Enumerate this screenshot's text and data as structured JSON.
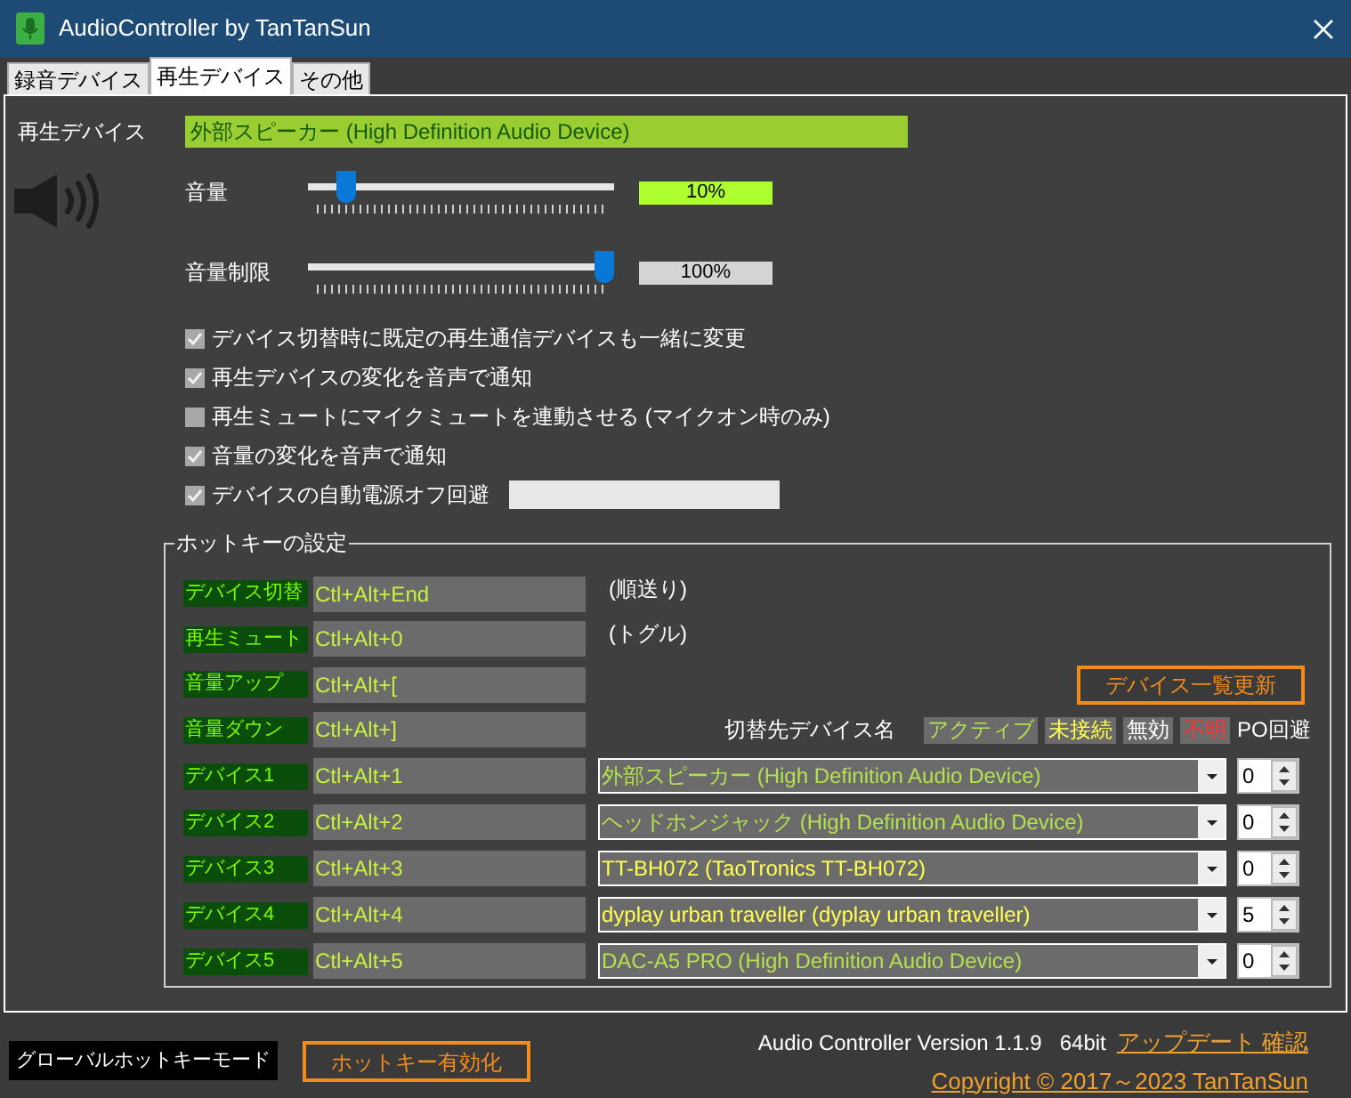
{
  "window": {
    "title": "AudioController by TanTanSun"
  },
  "tabs": [
    {
      "label": "録音デバイス",
      "selected": false
    },
    {
      "label": "再生デバイス",
      "selected": true
    },
    {
      "label": "その他",
      "selected": false
    }
  ],
  "device": {
    "label": "再生デバイス",
    "value": "外部スピーカー (High Definition Audio Device)"
  },
  "sliders": [
    {
      "label": "音量",
      "level": 0.1,
      "reading": "10%",
      "color": "#adff2f"
    },
    {
      "label": "音量制限",
      "level": 1,
      "reading": "100%",
      "color": "#d4d4d4"
    }
  ],
  "options": [
    {
      "kind": "plain",
      "label": "デバイス切替時に既定の再生通信デバイスも一緒に変更",
      "checked": true
    },
    {
      "kind": "plain",
      "label": "再生デバイスの変化を音声で通知",
      "checked": true
    },
    {
      "kind": "plain",
      "label": "再生ミュートにマイクミュートを連動させる (マイクオン時のみ)",
      "checked": false
    },
    {
      "kind": "plain",
      "label": "音量の変化を音声で通知",
      "checked": true
    },
    {
      "kind": "with-field",
      "label": "デバイスの自動電源オフ回避",
      "checked": true
    }
  ],
  "hotkeys": {
    "title": "ホットキーの設定",
    "actions": [
      {
        "label": "デバイス切替",
        "key": "Ctl+Alt+End",
        "note": "(順送り)"
      },
      {
        "label": "再生ミュート",
        "key": "Ctl+Alt+0",
        "note": "(トグル)"
      },
      {
        "label": "音量アップ",
        "key": "Ctl+Alt+["
      },
      {
        "label": "音量ダウン",
        "key": "Ctl+Alt+]"
      }
    ],
    "refresh_button": "デバイス一覧更新",
    "legend": {
      "title": "切替先デバイス名",
      "statuses": [
        {
          "label": "アクティブ",
          "kind": "active"
        },
        {
          "label": "未接続",
          "kind": "unplugged"
        },
        {
          "label": "無効",
          "kind": "disabled"
        },
        {
          "label": "不明",
          "kind": "unknown"
        }
      ],
      "po_label": "PO回避"
    },
    "devices": [
      {
        "label": "デバイス1",
        "key": "Ctl+Alt+1",
        "device": "外部スピーカー (High Definition Audio Device)",
        "kind": "active",
        "po": "0"
      },
      {
        "label": "デバイス2",
        "key": "Ctl+Alt+2",
        "device": "ヘッドホンジャック (High Definition Audio Device)",
        "kind": "active",
        "po": "0"
      },
      {
        "label": "デバイス3",
        "key": "Ctl+Alt+3",
        "device": "TT-BH072 (TaoTronics TT-BH072)",
        "kind": "unplugged",
        "po": "0"
      },
      {
        "label": "デバイス4",
        "key": "Ctl+Alt+4",
        "device": "dyplay urban traveller (dyplay urban traveller)",
        "kind": "unplugged",
        "po": "5"
      },
      {
        "label": "デバイス5",
        "key": "Ctl+Alt+5",
        "device": "DAC-A5 PRO (High Definition Audio Device)",
        "kind": "active",
        "po": "0"
      }
    ]
  },
  "footer": {
    "mode_label": "グローバルホットキーモード",
    "toggle_button": "ホットキー有効化",
    "version": "Audio Controller Version 1.1.9   64bit",
    "update_link": "アップデート 確認",
    "copyright_link": "Copyright © 2017～2023 TanTanSun"
  }
}
